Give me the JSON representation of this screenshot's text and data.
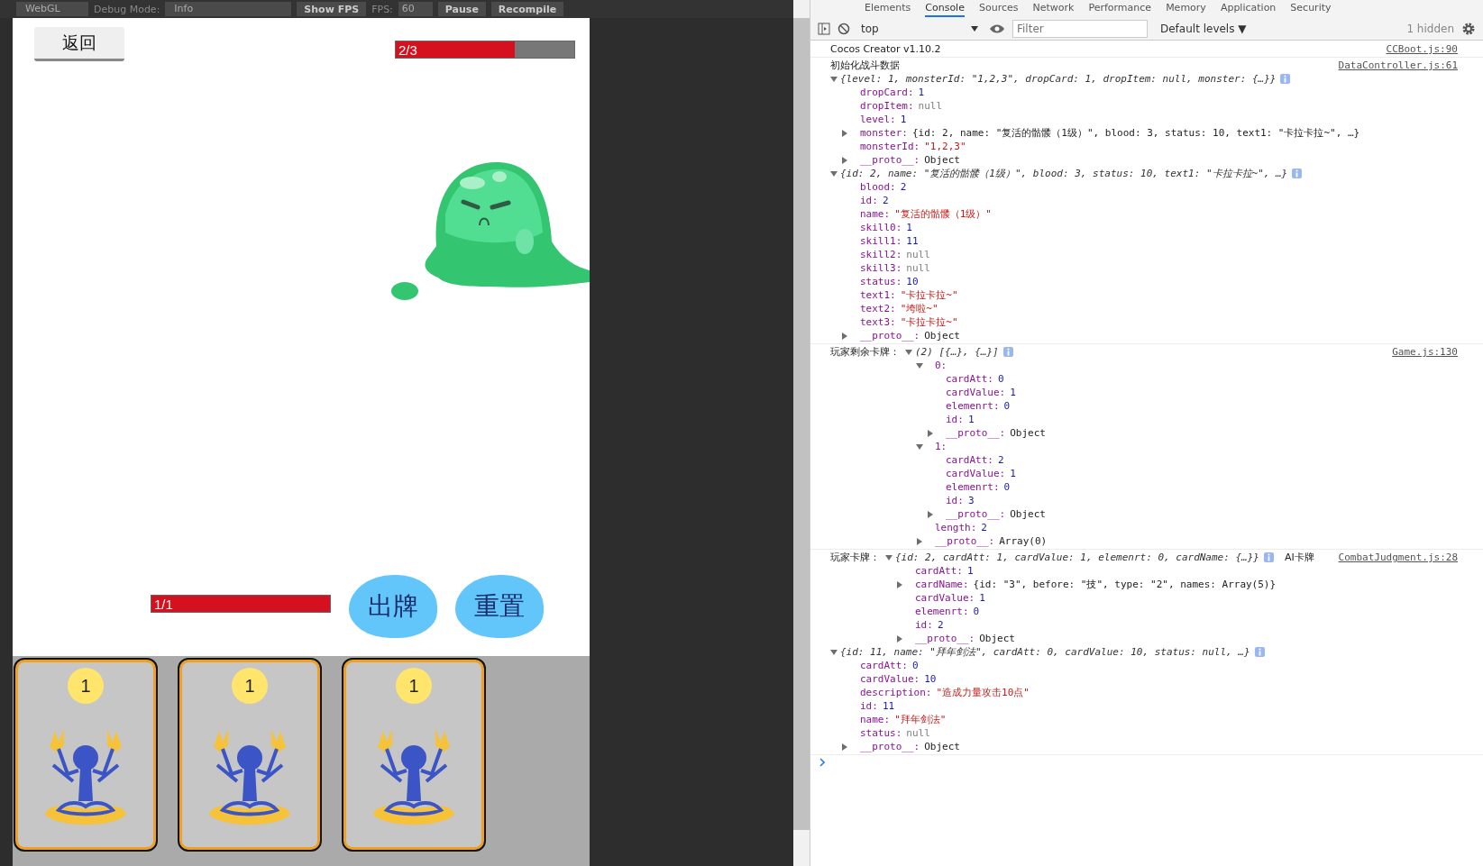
{
  "game_toolbar": [
    {
      "kind": "select",
      "text": "WebGL"
    },
    {
      "kind": "label",
      "text": "Debug Mode:"
    },
    {
      "kind": "select",
      "text": "Info"
    },
    {
      "kind": "button",
      "text": "Show FPS"
    },
    {
      "kind": "label",
      "text": "FPS:"
    },
    {
      "kind": "input",
      "text": "60"
    },
    {
      "kind": "button",
      "text": "Pause"
    },
    {
      "kind": "button",
      "text": "Recompile"
    }
  ],
  "game": {
    "back_button": "返回",
    "monster_hp": {
      "text": "2/3",
      "level": 0.667
    },
    "player_hp": {
      "text": "1/1",
      "level": 1
    },
    "action_buttons": [
      "出牌",
      "重置"
    ],
    "cards": [
      {
        "cost": "1"
      },
      {
        "cost": "1"
      },
      {
        "cost": "1"
      }
    ]
  },
  "devtools": {
    "tabs": [
      {
        "label": "Elements",
        "selected": false
      },
      {
        "label": "Console",
        "selected": true
      },
      {
        "label": "Sources",
        "selected": false
      },
      {
        "label": "Network",
        "selected": false
      },
      {
        "label": "Performance",
        "selected": false
      },
      {
        "label": "Memory",
        "selected": false
      },
      {
        "label": "Application",
        "selected": false
      },
      {
        "label": "Security",
        "selected": false
      }
    ],
    "context": "top",
    "filter": {
      "placeholder": "Filter"
    },
    "levels": "Default levels ▼",
    "hidden": "1 hidden",
    "messages": [
      {
        "label": "Cocos Creator v1.10.2",
        "source": "CCBoot.js:90"
      },
      {
        "label": "初始化战斗数据",
        "source": "DataController.js:61",
        "nodes": [
          {
            "expanded": true,
            "preview": "{level: 1, monsterId: \"1,2,3\", dropCard: 1, dropItem: null, monster: {…}}",
            "children": [
              {
                "key": "dropCard:",
                "value": "1",
                "kind": "number"
              },
              {
                "key": "dropItem:",
                "value": "null",
                "kind": "null"
              },
              {
                "key": "level:",
                "value": "1",
                "kind": "number"
              },
              {
                "key": "monster:",
                "value": "{id: 2, name: \"复活的骷髅（1级）\", blood: 3, status: 10, text1: \"卡拉卡拉~\", …}",
                "kind": "plain",
                "expanded": false
              },
              {
                "key": "monsterId:",
                "value": "\"1,2,3\"",
                "kind": "string"
              },
              {
                "key": "__proto__:",
                "value": "Object",
                "kind": "plain",
                "expanded": false
              }
            ]
          },
          {
            "expanded": true,
            "preview": "{id: 2, name: \"复活的骷髅（1级）\", blood: 3, status: 10, text1: \"卡拉卡拉~\", …}",
            "children": [
              {
                "key": "blood:",
                "value": "2",
                "kind": "number"
              },
              {
                "key": "id:",
                "value": "2",
                "kind": "number"
              },
              {
                "key": "name:",
                "value": "\"复活的骷髅（1级）\"",
                "kind": "string"
              },
              {
                "key": "skill0:",
                "value": "1",
                "kind": "number"
              },
              {
                "key": "skill1:",
                "value": "11",
                "kind": "number"
              },
              {
                "key": "skill2:",
                "value": "null",
                "kind": "null"
              },
              {
                "key": "skill3:",
                "value": "null",
                "kind": "null"
              },
              {
                "key": "status:",
                "value": "10",
                "kind": "number"
              },
              {
                "key": "text1:",
                "value": "\"卡拉卡拉~\"",
                "kind": "string"
              },
              {
                "key": "text2:",
                "value": "\"垮啦~\"",
                "kind": "string"
              },
              {
                "key": "text3:",
                "value": "\"卡拉卡拉~\"",
                "kind": "string"
              },
              {
                "key": "__proto__:",
                "value": "Object",
                "kind": "plain",
                "expanded": false
              }
            ]
          }
        ]
      },
      {
        "label": "玩家剩余卡牌：",
        "source": "Game.js:130",
        "inline_node": {
          "expanded": true,
          "preview": "(2) [{…}, {…}]",
          "children": [
            {
              "key": "0:",
              "expanded": true,
              "children": [
                {
                  "key": "cardAtt:",
                  "value": "0",
                  "kind": "number"
                },
                {
                  "key": "cardValue:",
                  "value": "1",
                  "kind": "number"
                },
                {
                  "key": "elemenrt:",
                  "value": "0",
                  "kind": "number"
                },
                {
                  "key": "id:",
                  "value": "1",
                  "kind": "number"
                },
                {
                  "key": "__proto__:",
                  "value": "Object",
                  "kind": "plain",
                  "expanded": false
                }
              ]
            },
            {
              "key": "1:",
              "expanded": true,
              "children": [
                {
                  "key": "cardAtt:",
                  "value": "2",
                  "kind": "number"
                },
                {
                  "key": "cardValue:",
                  "value": "1",
                  "kind": "number"
                },
                {
                  "key": "elemenrt:",
                  "value": "0",
                  "kind": "number"
                },
                {
                  "key": "id:",
                  "value": "3",
                  "kind": "number"
                },
                {
                  "key": "__proto__:",
                  "value": "Object",
                  "kind": "plain",
                  "expanded": false
                }
              ]
            },
            {
              "key": "length:",
              "value": "2",
              "kind": "number"
            },
            {
              "key": "__proto__:",
              "value": "Array(0)",
              "kind": "plain",
              "expanded": false
            }
          ]
        }
      },
      {
        "label": "玩家卡牌：",
        "source": "CombatJudgment.js:28",
        "suffix": "AI卡牌",
        "inline_node": {
          "expanded": true,
          "preview": "{id: 2, cardAtt: 1, cardValue: 1, elemenrt: 0, cardName: {…}}",
          "children": [
            {
              "key": "cardAtt:",
              "value": "1",
              "kind": "number"
            },
            {
              "key": "cardName:",
              "value": "{id: \"3\", before: \"技\", type: \"2\", names: Array(5)}",
              "kind": "plain",
              "expanded": false
            },
            {
              "key": "cardValue:",
              "value": "1",
              "kind": "number"
            },
            {
              "key": "elemenrt:",
              "value": "0",
              "kind": "number"
            },
            {
              "key": "id:",
              "value": "2",
              "kind": "number"
            },
            {
              "key": "__proto__:",
              "value": "Object",
              "kind": "plain",
              "expanded": false
            }
          ]
        },
        "nodes": [
          {
            "expanded": true,
            "preview": "{id: 11, name: \"拜年剑法\", cardAtt: 0, cardValue: 10, status: null, …}",
            "children": [
              {
                "key": "cardAtt:",
                "value": "0",
                "kind": "number"
              },
              {
                "key": "cardValue:",
                "value": "10",
                "kind": "number"
              },
              {
                "key": "description:",
                "value": "\"造成力量攻击10点\"",
                "kind": "string"
              },
              {
                "key": "id:",
                "value": "11",
                "kind": "number"
              },
              {
                "key": "name:",
                "value": "\"拜年剑法\"",
                "kind": "string"
              },
              {
                "key": "status:",
                "value": "null",
                "kind": "null"
              },
              {
                "key": "__proto__:",
                "value": "Object",
                "kind": "plain",
                "expanded": false
              }
            ]
          }
        ]
      }
    ]
  }
}
